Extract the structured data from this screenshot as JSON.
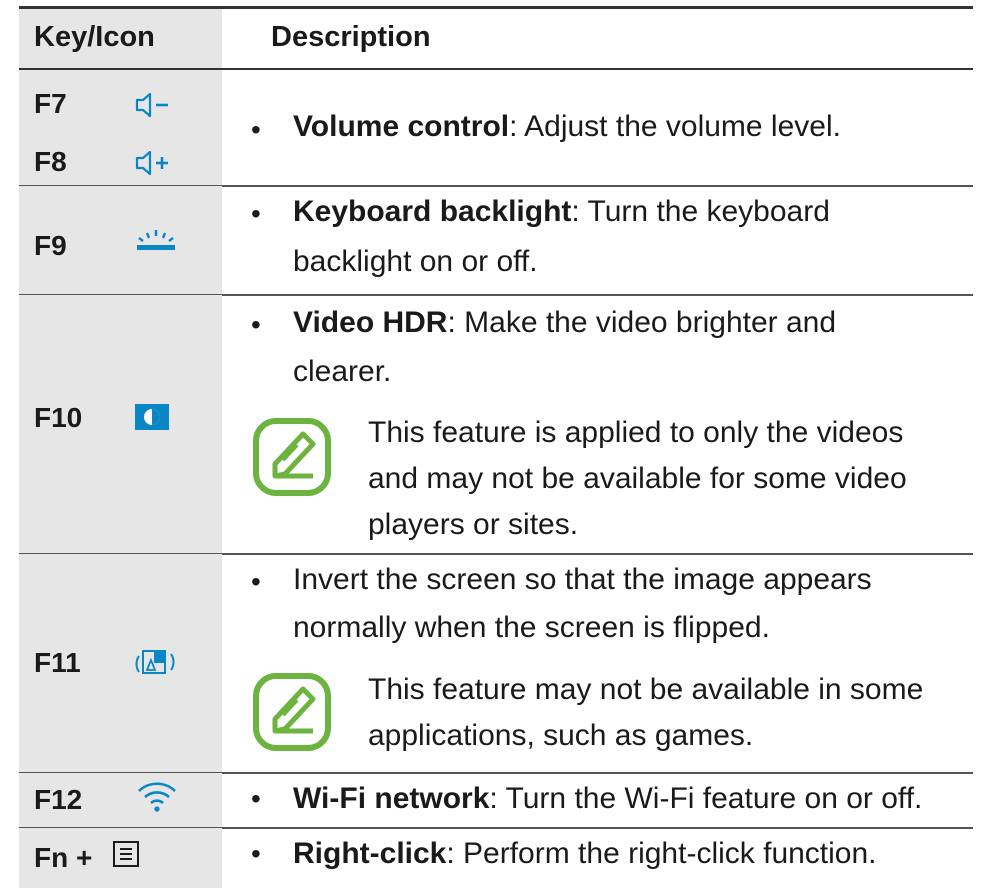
{
  "header": {
    "key_icon": "Key/Icon",
    "description": "Description"
  },
  "rows": {
    "volume": {
      "keys": [
        "F7",
        "F8"
      ],
      "icons": [
        "volume-down-icon",
        "volume-up-icon"
      ],
      "title": "Volume control",
      "text": ": Adjust the volume level."
    },
    "backlight": {
      "key": "F9",
      "icon": "keyboard-backlight-icon",
      "title": "Keyboard backlight",
      "text_line1": ": Turn the keyboard",
      "text_line2": "backlight on or off."
    },
    "hdr": {
      "key": "F10",
      "icon": "video-hdr-icon",
      "title": "Video HDR",
      "text_line1": ": Make the video brighter and",
      "text_line2": "clearer.",
      "note_icon": "note-pen-icon",
      "note_lines": [
        "This feature is applied to only the videos",
        "and may not be available for some video",
        "players or sites."
      ]
    },
    "invert": {
      "key": "F11",
      "icon": "screen-invert-icon",
      "text_line1": "Invert the screen so that the image appears",
      "text_line2": "normally when the screen is flipped.",
      "note_icon": "note-pen-icon",
      "note_lines": [
        "This feature may not be available in some",
        "applications, such as games."
      ]
    },
    "wifi": {
      "key": "F12",
      "icon": "wifi-icon",
      "title": "Wi-Fi network",
      "text": ": Turn the Wi-Fi feature on or off."
    },
    "rightclick": {
      "key": "Fn +",
      "icon": "menu-key-icon",
      "title": "Right-click",
      "text": ": Perform the right-click function."
    }
  },
  "bullet": "•",
  "colors": {
    "key_bg": "#e6e6e6",
    "icon_blue": "#0a86c6",
    "note_green": "#6cb33f"
  }
}
